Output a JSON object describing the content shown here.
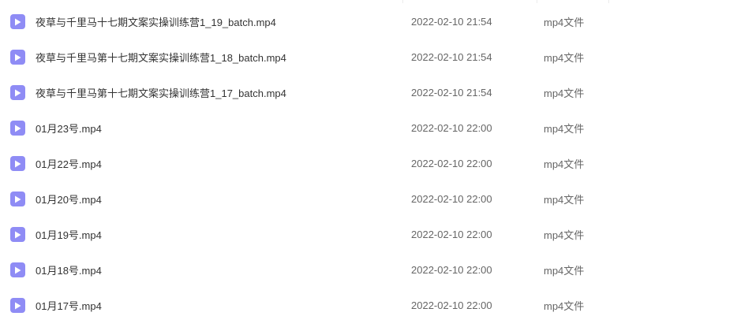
{
  "colors": {
    "video_icon_bg": "#8f8cf5",
    "video_icon_glyph": "#ffffff"
  },
  "files": [
    {
      "icon": "video-file-icon",
      "name": "夜草与千里马十七期文案实操训练营1_19_batch.mp4",
      "modified": "2022-02-10 21:54",
      "type": "mp4文件"
    },
    {
      "icon": "video-file-icon",
      "name": "夜草与千里马第十七期文案实操训练营1_18_batch.mp4",
      "modified": "2022-02-10 21:54",
      "type": "mp4文件"
    },
    {
      "icon": "video-file-icon",
      "name": "夜草与千里马第十七期文案实操训练营1_17_batch.mp4",
      "modified": "2022-02-10 21:54",
      "type": "mp4文件"
    },
    {
      "icon": "video-file-icon",
      "name": "01月23号.mp4",
      "modified": "2022-02-10 22:00",
      "type": "mp4文件"
    },
    {
      "icon": "video-file-icon",
      "name": "01月22号.mp4",
      "modified": "2022-02-10 22:00",
      "type": "mp4文件"
    },
    {
      "icon": "video-file-icon",
      "name": "01月20号.mp4",
      "modified": "2022-02-10 22:00",
      "type": "mp4文件"
    },
    {
      "icon": "video-file-icon",
      "name": "01月19号.mp4",
      "modified": "2022-02-10 22:00",
      "type": "mp4文件"
    },
    {
      "icon": "video-file-icon",
      "name": "01月18号.mp4",
      "modified": "2022-02-10 22:00",
      "type": "mp4文件"
    },
    {
      "icon": "video-file-icon",
      "name": "01月17号.mp4",
      "modified": "2022-02-10 22:00",
      "type": "mp4文件"
    }
  ]
}
